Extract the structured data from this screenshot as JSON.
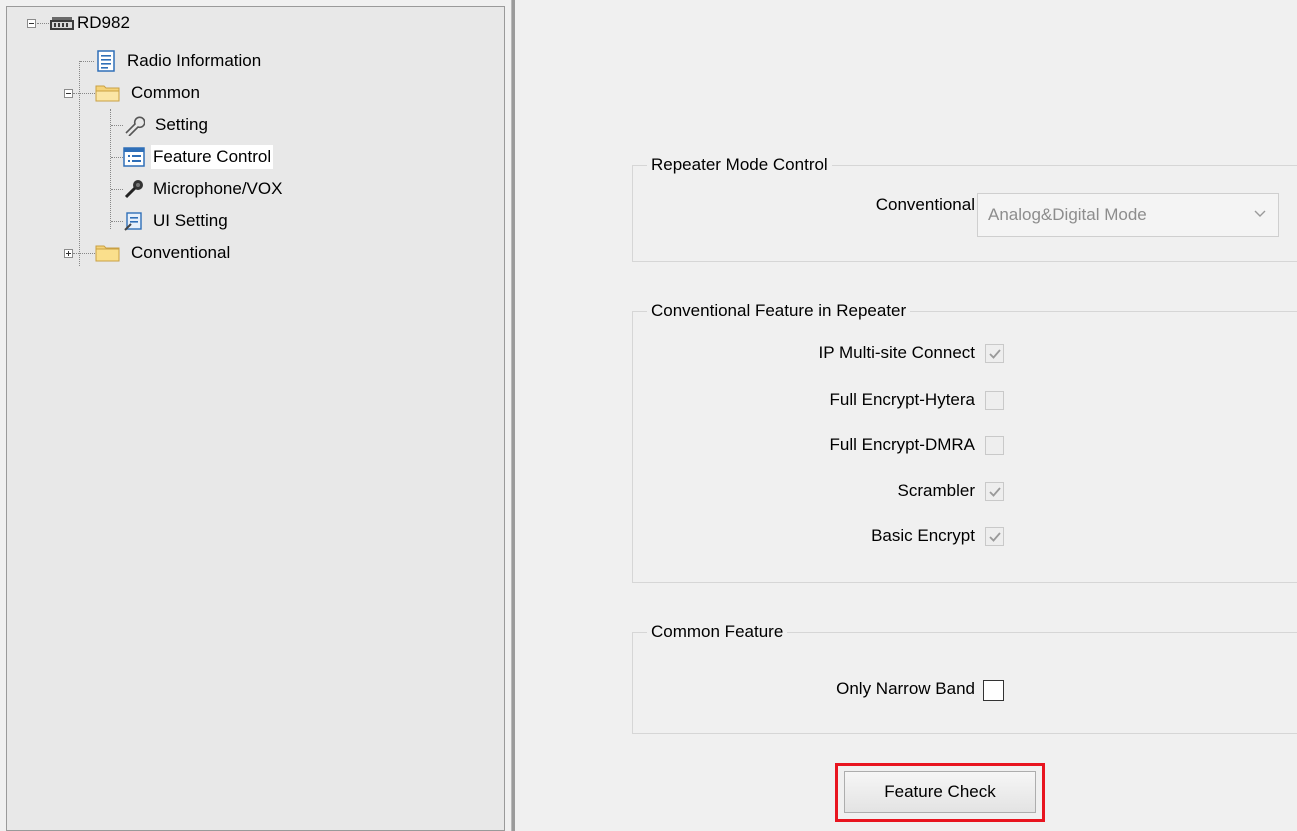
{
  "tree": {
    "root": {
      "label": "RD982",
      "icon": "radio-device-icon",
      "expanded": true
    },
    "items": [
      {
        "label": "Radio Information",
        "icon": "document-icon"
      },
      {
        "label": "Common",
        "icon": "folder-open-icon",
        "expanded": true,
        "children": [
          {
            "label": "Setting",
            "icon": "wrench-icon"
          },
          {
            "label": "Feature Control",
            "icon": "list-window-icon",
            "selected": true
          },
          {
            "label": "Microphone/VOX",
            "icon": "microphone-icon"
          },
          {
            "label": "UI Setting",
            "icon": "ui-setting-icon"
          }
        ]
      },
      {
        "label": "Conventional",
        "icon": "folder-closed-icon",
        "expanded": false
      }
    ]
  },
  "repeater_mode_control": {
    "title": "Repeater Mode Control",
    "conventional_label": "Conventional",
    "conventional_value": "Analog&Digital Mode",
    "enabled": false
  },
  "conventional_feature": {
    "title": "Conventional Feature in Repeater",
    "options": [
      {
        "label": "IP Multi-site Connect",
        "checked": true,
        "enabled": false
      },
      {
        "label": "Full Encrypt-Hytera",
        "checked": false,
        "enabled": false
      },
      {
        "label": "Full Encrypt-DMRA",
        "checked": false,
        "enabled": false
      },
      {
        "label": "Scrambler",
        "checked": true,
        "enabled": false
      },
      {
        "label": "Basic Encrypt",
        "checked": true,
        "enabled": false
      }
    ]
  },
  "common_feature": {
    "title": "Common Feature",
    "options": [
      {
        "label": "Only Narrow Band",
        "checked": false,
        "enabled": true
      }
    ]
  },
  "buttons": {
    "feature_check": "Feature Check"
  },
  "colors": {
    "highlight": "#e8141f",
    "selection_bg": "#ffffff",
    "pane_bg": "#e8e8e8",
    "window_bg": "#f0f0f0"
  }
}
